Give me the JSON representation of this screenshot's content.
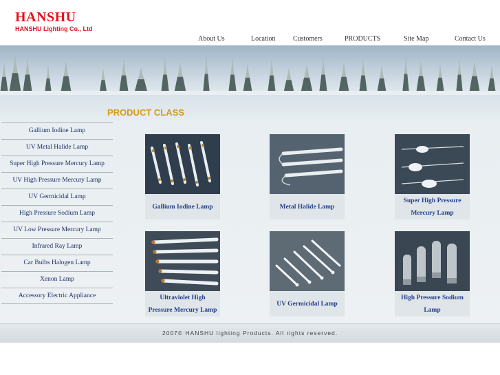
{
  "brand": {
    "name": "HANSHU",
    "company": "HANSHU Lighting Co., Ltd"
  },
  "nav": {
    "items": [
      "About Us",
      "Location",
      "Customers",
      "PRODUCTS",
      "Site Map",
      "Contact Us"
    ]
  },
  "main": {
    "section_title": "PRODUCT CLASS"
  },
  "sidebar": {
    "items": [
      "Gallium Iodine Lamp",
      "UV Metal Halide Lamp",
      "Super High Pressure Mercury Lamp",
      "UV High Pressure Mercury Lamp",
      "UV Germicidal Lamp",
      "High Pressure Sodium Lamp",
      "UV Low Pressure Mercury Lamp",
      "Infrared Ray Lamp",
      "Car Bulbs Halogen Lamp",
      "Xenon Lamp",
      "Accessory Electric Appliance"
    ]
  },
  "products": [
    {
      "lines": [
        "Gallium Iodine Lamp"
      ]
    },
    {
      "lines": [
        "Metal Halide Lamp"
      ]
    },
    {
      "lines": [
        "Super High Pressure",
        "Mercury Lamp"
      ]
    },
    {
      "lines": [
        "Ultraviolet High",
        "Pressure Mercury Lamp"
      ]
    },
    {
      "lines": [
        "UV Germicidal Lamp"
      ]
    },
    {
      "lines": [
        "High Pressure Sodium",
        "Lamp"
      ]
    }
  ],
  "footer": {
    "copyright": "2007© HANSHU lighting Products. All rights reserved."
  },
  "colors": {
    "logo_red": "#e3111a",
    "title_gold": "#d49a1c",
    "link_blue": "#26408e"
  }
}
